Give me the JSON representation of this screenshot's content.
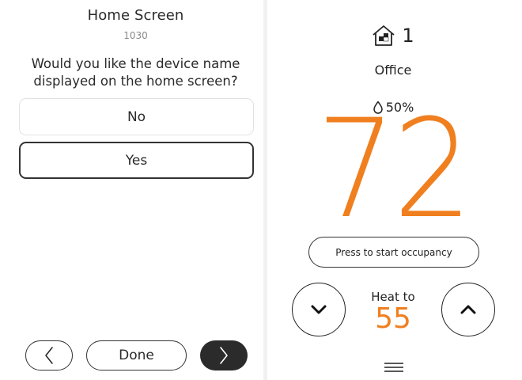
{
  "setup": {
    "title": "Home Screen",
    "code": "1030",
    "question": "Would you like the device name displayed on the home screen?",
    "options": [
      {
        "label": "No",
        "selected": false
      },
      {
        "label": "Yes",
        "selected": true
      }
    ],
    "nav": {
      "back_icon": "chevron-left-icon",
      "done_label": "Done",
      "next_icon": "chevron-right-icon"
    }
  },
  "home": {
    "zone_icon": "home-zone-icon",
    "zone_number": "1",
    "device_name": "Office",
    "humidity": "50%",
    "humidity_icon": "water-drop-icon",
    "temperature": "72",
    "occupancy_label": "Press to start occupancy",
    "mode_label": "Heat to",
    "setpoint": "55",
    "down_icon": "chevron-down-icon",
    "up_icon": "chevron-up-icon",
    "menu_icon": "menu-icon"
  },
  "colors": {
    "accent": "#f07f1f",
    "dark": "#2b2b2b",
    "border_light": "#e2e2e2"
  }
}
